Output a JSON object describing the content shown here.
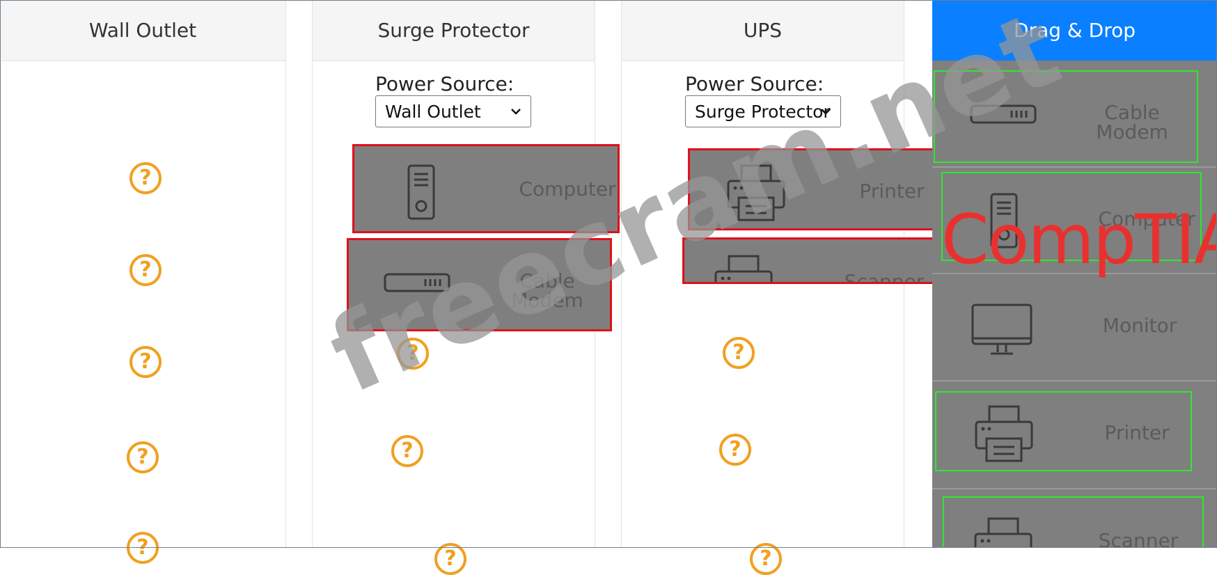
{
  "columns": [
    {
      "title": "Wall Outlet"
    },
    {
      "title": "Surge Protector",
      "power_source_label": "Power Source:",
      "power_source_value": "Wall Outlet"
    },
    {
      "title": "UPS",
      "power_source_label": "Power Source:",
      "power_source_value": "Surge Protector"
    },
    {
      "title": "Drag & Drop"
    }
  ],
  "placed": {
    "surge_protector": [
      {
        "label": "Computer",
        "icon": "computer-tower-icon"
      },
      {
        "label": "Cable\nModem",
        "icon": "cable-modem-icon"
      }
    ],
    "ups": [
      {
        "label": "Printer",
        "icon": "printer-icon"
      },
      {
        "label": "Scanner",
        "icon": "scanner-icon"
      }
    ]
  },
  "drag_items": [
    {
      "label": "Cable\nModem",
      "icon": "cable-modem-icon"
    },
    {
      "label": "Computer",
      "icon": "computer-tower-icon"
    },
    {
      "label": "Monitor",
      "icon": "monitor-icon"
    },
    {
      "label": "Printer",
      "icon": "printer-icon"
    },
    {
      "label": "Scanner",
      "icon": "scanner-icon"
    }
  ],
  "placeholder_symbol": "?",
  "watermark": "freecram.net",
  "logo": "CompTIA",
  "colors": {
    "accent_blue": "#0a7fff",
    "placeholder_orange": "#f0a020",
    "card_gray": "#7f7f7f",
    "incorrect_red": "#e0101a",
    "correct_green": "#2ee82e",
    "logo_red": "#e8312f"
  }
}
